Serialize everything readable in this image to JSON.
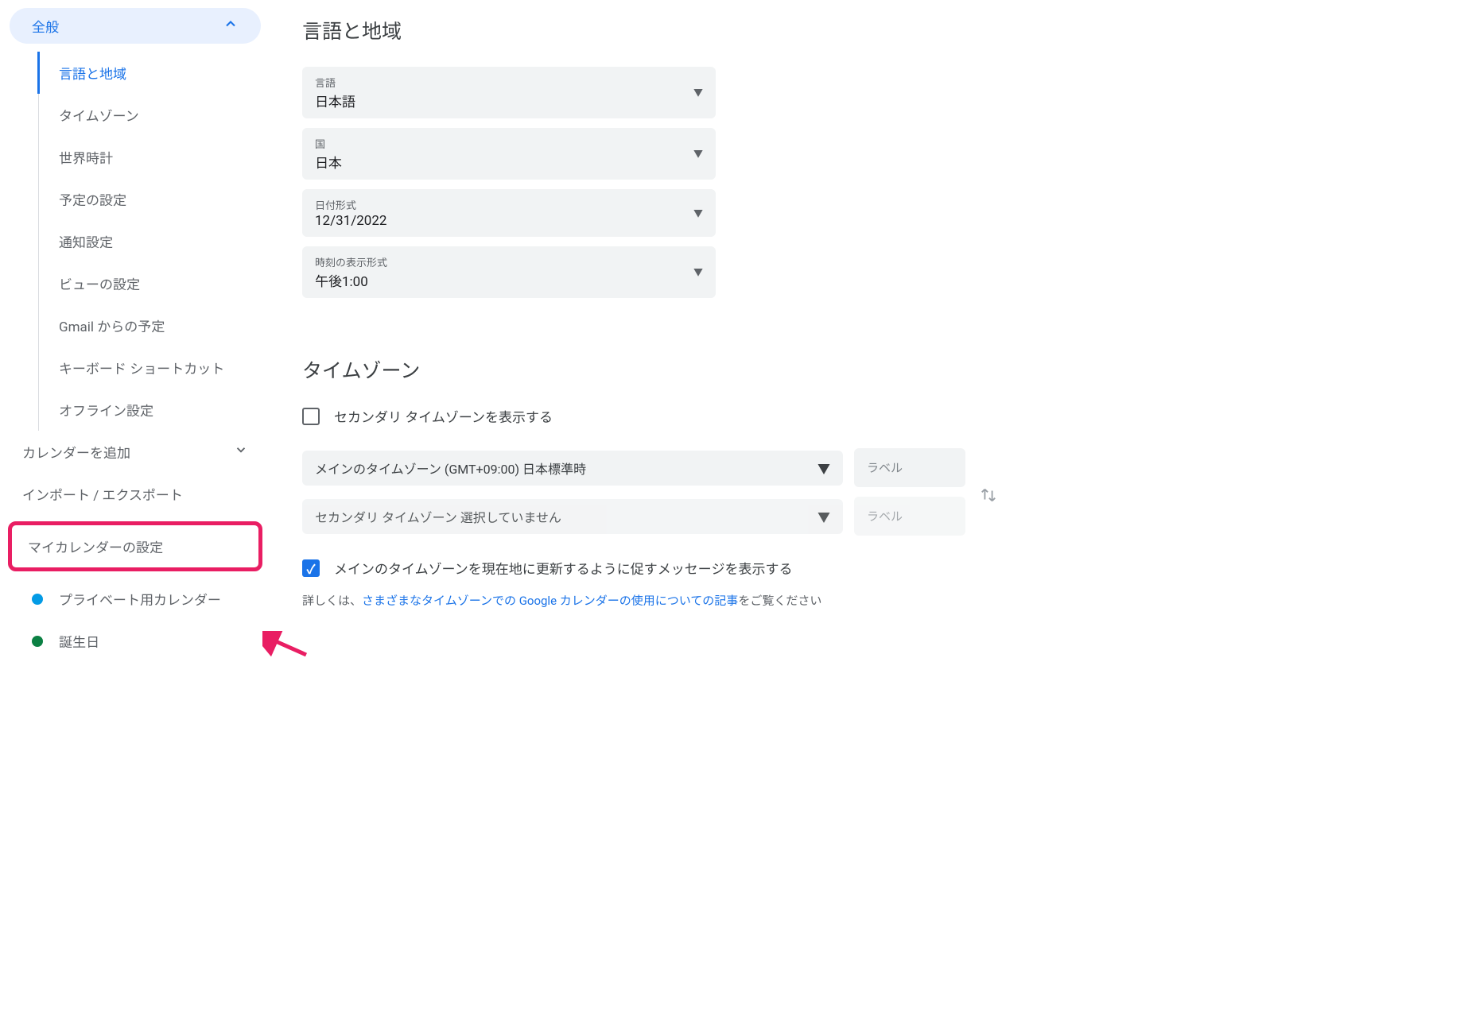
{
  "sidebar": {
    "general": "全般",
    "items": [
      "言語と地域",
      "タイムゾーン",
      "世界時計",
      "予定の設定",
      "通知設定",
      "ビューの設定",
      "Gmail からの予定",
      "キーボード ショートカット",
      "オフライン設定"
    ],
    "add_calendar": "カレンダーを追加",
    "import_export": "インポート / エクスポート",
    "my_calendar_settings": "マイカレンダーの設定",
    "calendars": [
      {
        "label": "プライベート用カレンダー",
        "color": "#039be5"
      },
      {
        "label": "誕生日",
        "color": "#0b8043"
      }
    ]
  },
  "main": {
    "lang_region": {
      "title": "言語と地域",
      "fields": {
        "language": {
          "label": "言語",
          "value": "日本語"
        },
        "country": {
          "label": "国",
          "value": "日本"
        },
        "date_format": {
          "label": "日付形式",
          "value": "12/31/2022"
        },
        "time_format": {
          "label": "時刻の表示形式",
          "value": "午後1:00"
        }
      }
    },
    "timezone": {
      "title": "タイムゾーン",
      "show_secondary": "セカンダリ タイムゾーンを表示する",
      "main_tz": {
        "label": "メインのタイムゾーン",
        "value": "(GMT+09:00) 日本標準時"
      },
      "main_label": "ラベル",
      "secondary_tz": {
        "label": "セカンダリ タイムゾーン",
        "placeholder": "選択していません"
      },
      "secondary_label": "ラベル",
      "prompt_update": "メインのタイムゾーンを現在地に更新するように促すメッセージを表示する",
      "help_prefix": "詳しくは、",
      "help_link": "さまざまなタイムゾーンでの Google カレンダーの使用についての記事",
      "help_suffix": "をご覧ください"
    }
  }
}
